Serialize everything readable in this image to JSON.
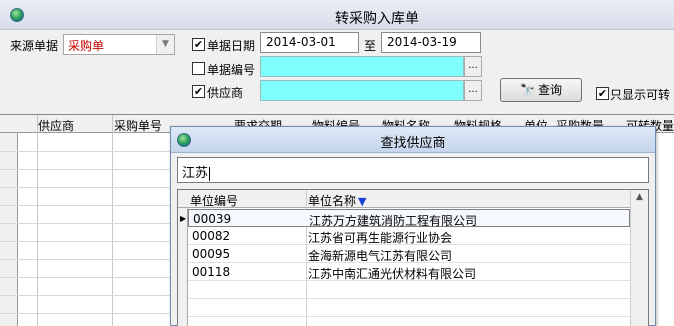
{
  "window": {
    "title": "转采购入库单"
  },
  "filters": {
    "source_label": "来源单据",
    "source_value": "采购单",
    "date_label": "单据日期",
    "date_checked": true,
    "date_from": "2014-03-01",
    "date_to_label": "至",
    "date_to": "2014-03-19",
    "docno_label": "单据编号",
    "docno_checked": false,
    "docno_value": "",
    "supplier_label": "供应商",
    "supplier_checked": true,
    "supplier_value": "",
    "more_button": "...",
    "query_button": "查询",
    "only_show_label": "只显示可转",
    "only_show_checked": true
  },
  "grid": {
    "columns": [
      "供应商",
      "采购单号",
      "要求交期",
      "物料编号",
      "物料名称",
      "物料规格",
      "单位",
      "采购数量",
      "可转数量"
    ]
  },
  "dialog": {
    "title": "查找供应商",
    "search_value": "江苏",
    "columns": [
      "单位编号",
      "单位名称"
    ],
    "sort_indicator": "▼",
    "rows": [
      {
        "code": "00039",
        "name": "江苏万方建筑消防工程有限公司"
      },
      {
        "code": "00082",
        "name": "江苏省可再生能源行业协会"
      },
      {
        "code": "00095",
        "name": "金海新源电气江苏有限公司"
      },
      {
        "code": "00118",
        "name": "江苏中南汇通光伏材料有限公司"
      }
    ],
    "selected_row": 0
  },
  "icons": {
    "app_logo": "app-globe-icon",
    "binoculars": "binoculars-icon",
    "checkmark": "checkmark-icon",
    "combo_arrow": "chevron-down-icon",
    "row_pointer": "row-pointer-icon",
    "scroll_up": "scroll-up-icon"
  },
  "colors": {
    "source_value_text": "#c40000",
    "supplier_field_bg": "#80ffff",
    "sort_arrow": "#1a3fd6"
  }
}
